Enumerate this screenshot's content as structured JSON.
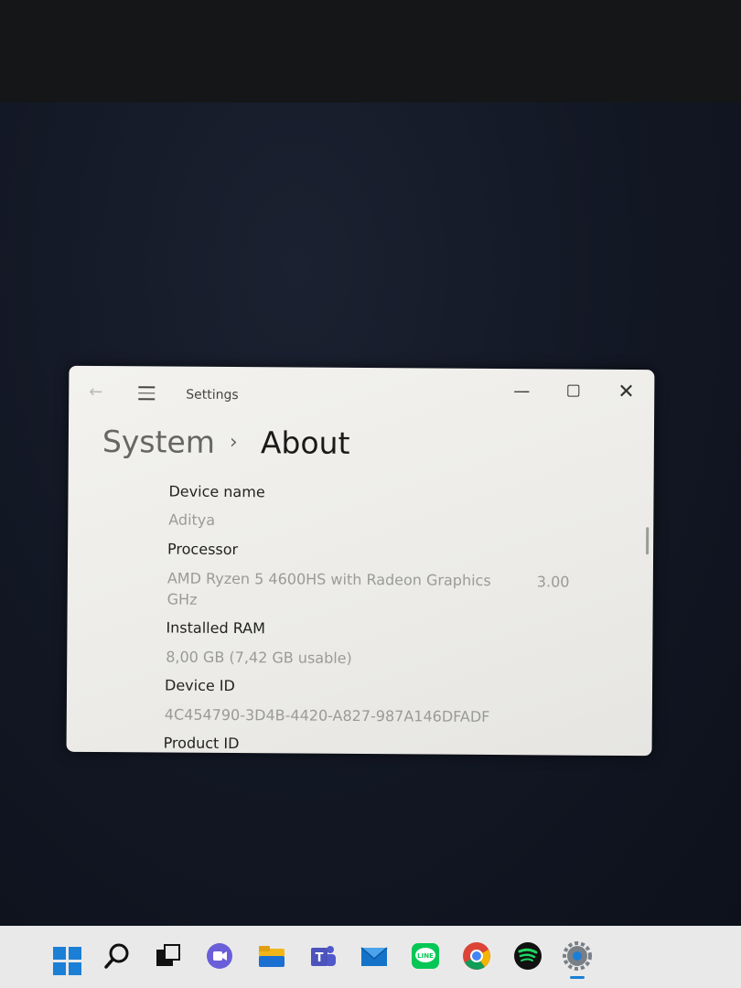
{
  "window": {
    "app_title": "Settings",
    "back_icon": "←",
    "minimize": "—",
    "close": "✕"
  },
  "breadcrumb": {
    "parent": "System",
    "separator": "›",
    "current": "About"
  },
  "specs": [
    {
      "label": "Device name",
      "value": "Aditya"
    },
    {
      "label": "Processor",
      "value": "AMD Ryzen 5 4600HS with Radeon Graphics",
      "value_suffix": "3.00",
      "value_line2": "GHz"
    },
    {
      "label": "Installed RAM",
      "value": "8,00 GB (7,42 GB usable)"
    },
    {
      "label": "Device ID",
      "value": "4C454790-3D4B-4420-A827-987A146DFADF"
    },
    {
      "label": "Product ID"
    }
  ],
  "taskbar": {
    "icons": [
      "windows-start-icon",
      "search-icon",
      "task-view-icon",
      "chat-icon",
      "file-explorer-icon",
      "teams-icon",
      "mail-icon",
      "line-icon",
      "chrome-icon",
      "spotify-icon",
      "settings-icon"
    ],
    "line_label": "LINE"
  },
  "colors": {
    "accent": "#1c7fd6",
    "window_bg": "#f0efeb",
    "screen_bg": "#121724"
  }
}
